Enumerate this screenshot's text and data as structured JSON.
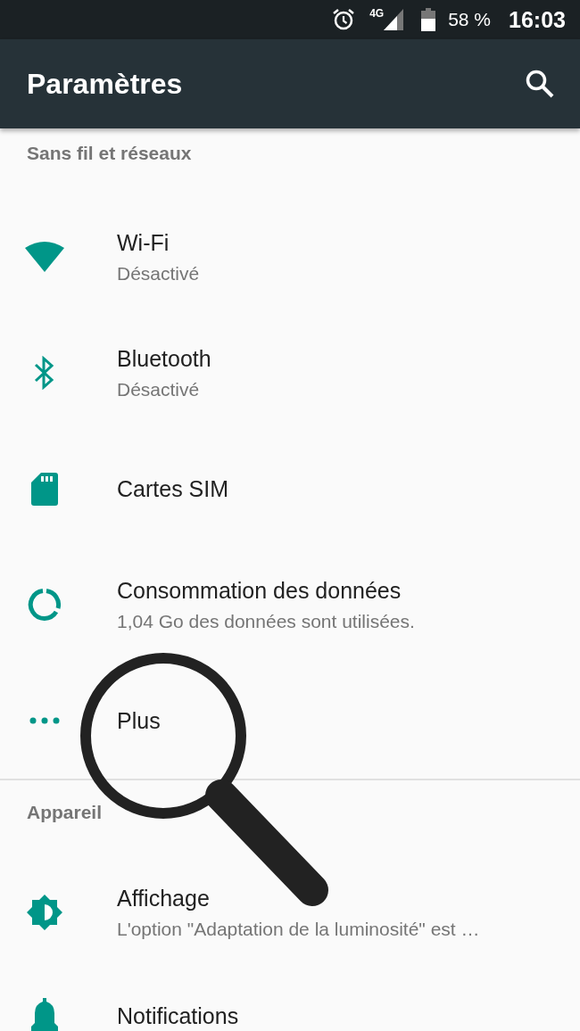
{
  "status_bar": {
    "network": "4G",
    "battery": "58 %",
    "time": "16:03"
  },
  "toolbar": {
    "title": "Paramètres"
  },
  "sections": [
    {
      "title": "Sans fil et réseaux",
      "items": [
        {
          "title": "Wi-Fi",
          "subtitle": "Désactivé"
        },
        {
          "title": "Bluetooth",
          "subtitle": "Désactivé"
        },
        {
          "title": "Cartes SIM"
        },
        {
          "title": "Consommation des données",
          "subtitle": "1,04 Go des données sont utilisées."
        },
        {
          "title": "Plus"
        }
      ]
    },
    {
      "title": "Appareil",
      "items": [
        {
          "title": "Affichage",
          "subtitle": "L'option \"Adaptation de la luminosité\" est …"
        },
        {
          "title": "Notifications"
        }
      ]
    }
  ]
}
